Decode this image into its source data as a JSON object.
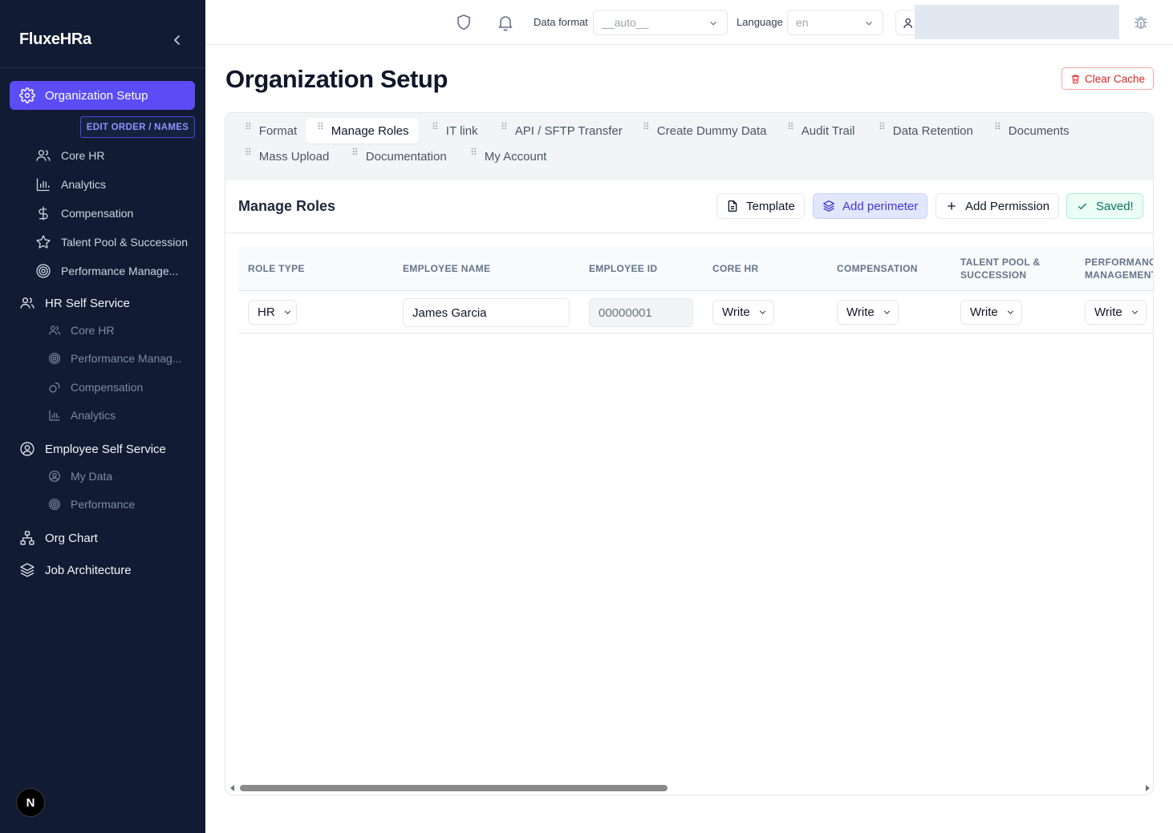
{
  "sidebar": {
    "brand": "FluxeHRa",
    "active_item": "Organization Setup",
    "edit_order_label": "EDIT ORDER / NAMES",
    "org_items": [
      {
        "label": "Core HR",
        "icon": "users-icon"
      },
      {
        "label": "Analytics",
        "icon": "bar-chart-icon"
      },
      {
        "label": "Compensation",
        "icon": "dollar-icon"
      },
      {
        "label": "Talent Pool & Succession",
        "icon": "star-icon"
      },
      {
        "label": "Performance Manage...",
        "icon": "target-icon"
      }
    ],
    "hr_self_service": {
      "label": "HR Self Service",
      "items": [
        {
          "label": "Core HR",
          "icon": "users-icon"
        },
        {
          "label": "Performance Manag...",
          "icon": "target-icon"
        },
        {
          "label": "Compensation",
          "icon": "coins-icon"
        },
        {
          "label": "Analytics",
          "icon": "bar-chart-icon"
        }
      ]
    },
    "employee_self_service": {
      "label": "Employee Self Service",
      "items": [
        {
          "label": "My Data",
          "icon": "user-circle-icon"
        },
        {
          "label": "Performance",
          "icon": "target-icon"
        }
      ]
    },
    "org_chart": "Org Chart",
    "job_architecture": "Job Architecture",
    "badge": "N"
  },
  "topbar": {
    "data_format_label": "Data format",
    "data_format_value": "__auto__",
    "language_label": "Language",
    "language_value": "en"
  },
  "page": {
    "title": "Organization Setup",
    "clear_cache": "Clear Cache"
  },
  "tabs": [
    {
      "label": "Format",
      "active": false
    },
    {
      "label": "Manage Roles",
      "active": true
    },
    {
      "label": "IT link",
      "active": false
    },
    {
      "label": "API / SFTP Transfer",
      "active": false
    },
    {
      "label": "Create Dummy Data",
      "active": false
    },
    {
      "label": "Audit Trail",
      "active": false
    },
    {
      "label": "Data Retention",
      "active": false
    },
    {
      "label": "Documents",
      "active": false
    },
    {
      "label": "Mass Upload",
      "active": false
    },
    {
      "label": "Documentation",
      "active": false
    },
    {
      "label": "My Account",
      "active": false
    }
  ],
  "section": {
    "title": "Manage Roles",
    "template_button": "Template",
    "add_perimeter_button": "Add perimeter",
    "add_permission_button": "Add Permission",
    "saved_button": "Saved!"
  },
  "table": {
    "columns": [
      "ROLE TYPE",
      "EMPLOYEE NAME",
      "EMPLOYEE ID",
      "CORE HR",
      "COMPENSATION",
      "TALENT POOL & SUCCESSION",
      "PERFORMANCE MANAGEMENT"
    ],
    "rows": [
      {
        "role_type": "HR",
        "employee_name": "James Garcia",
        "employee_id": "00000001",
        "core_hr": "Write",
        "compensation": "Write",
        "talent_pool": "Write",
        "performance": "Write"
      }
    ]
  },
  "colors": {
    "sidebar_bg": "#111b33",
    "accent": "#5b4cf5",
    "danger": "#dc2626",
    "success": "#047857"
  }
}
